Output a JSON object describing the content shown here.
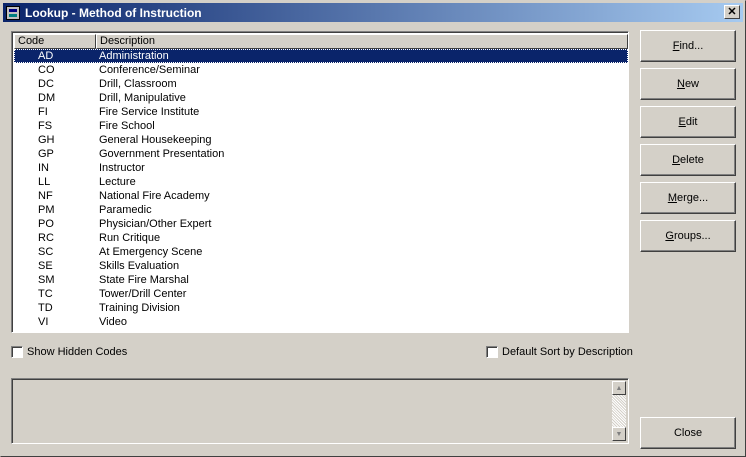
{
  "window": {
    "title": "Lookup - Method of Instruction",
    "close_glyph": "✕"
  },
  "list": {
    "columns": [
      "Code",
      "Description"
    ],
    "rows": [
      {
        "code": "AD",
        "description": "Administration",
        "selected": true
      },
      {
        "code": "CO",
        "description": "Conference/Seminar"
      },
      {
        "code": "DC",
        "description": "Drill, Classroom"
      },
      {
        "code": "DM",
        "description": "Drill, Manipulative"
      },
      {
        "code": "FI",
        "description": "Fire Service Institute"
      },
      {
        "code": "FS",
        "description": "Fire School"
      },
      {
        "code": "GH",
        "description": "General Housekeeping"
      },
      {
        "code": "GP",
        "description": "Government Presentation"
      },
      {
        "code": "IN",
        "description": "Instructor"
      },
      {
        "code": "LL",
        "description": "Lecture"
      },
      {
        "code": "NF",
        "description": "National Fire Academy"
      },
      {
        "code": "PM",
        "description": "Paramedic"
      },
      {
        "code": "PO",
        "description": "Physician/Other Expert"
      },
      {
        "code": "RC",
        "description": "Run Critique"
      },
      {
        "code": "SC",
        "description": "At Emergency Scene"
      },
      {
        "code": "SE",
        "description": "Skills Evaluation"
      },
      {
        "code": "SM",
        "description": "State Fire Marshal"
      },
      {
        "code": "TC",
        "description": "Tower/Drill Center"
      },
      {
        "code": "TD",
        "description": "Training Division"
      },
      {
        "code": "VI",
        "description": "Video"
      }
    ]
  },
  "options": {
    "show_hidden_codes": {
      "label": "Show Hidden Codes",
      "checked": false
    },
    "default_sort": {
      "label": "Default Sort by Description",
      "checked": false
    }
  },
  "buttons": {
    "find": {
      "label": "Find...",
      "accel": "F"
    },
    "new": {
      "label": "New",
      "accel": "N"
    },
    "edit": {
      "label": "Edit",
      "accel": "E"
    },
    "delete": {
      "label": "Delete",
      "accel": "D"
    },
    "merge": {
      "label": "Merge...",
      "accel": "M"
    },
    "groups": {
      "label": "Groups...",
      "accel": "G"
    },
    "close": {
      "label": "Close"
    }
  },
  "colors": {
    "titlebar_start": "#0a246a",
    "titlebar_end": "#a6caf0",
    "selection": "#0a246a",
    "face": "#d4d0c8"
  }
}
